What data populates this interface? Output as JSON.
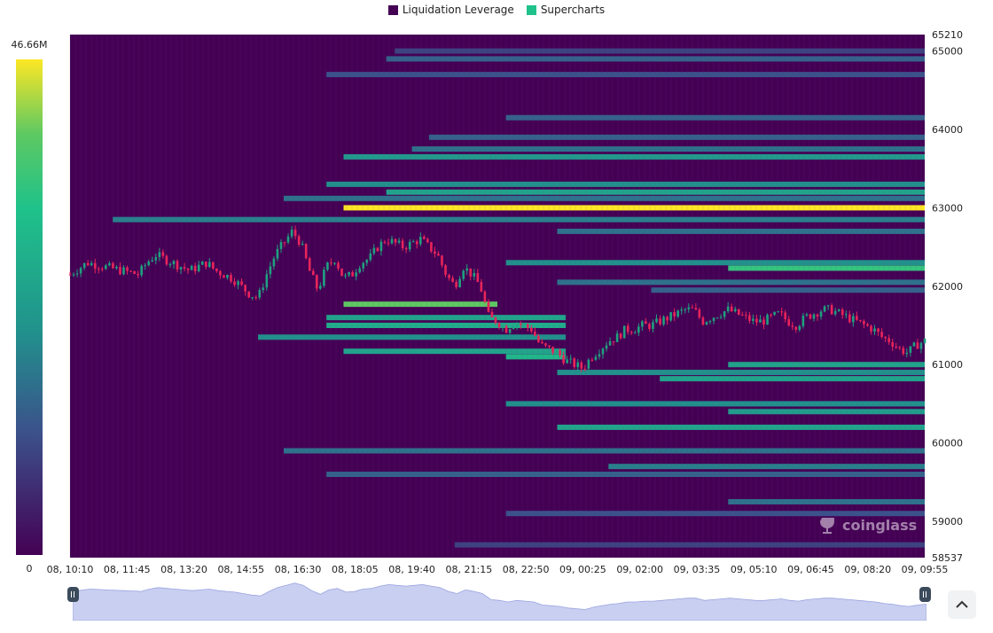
{
  "legend": [
    {
      "label": "Liquidation Leverage",
      "color": "#440154"
    },
    {
      "label": "Supercharts",
      "color": "#1fc28a"
    }
  ],
  "watermark": "coinglass",
  "chart_data": {
    "type": "heatmap",
    "title": "",
    "xlabel": "",
    "ylabel": "",
    "x_ticks": [
      "08, 10:10",
      "08, 11:45",
      "08, 13:20",
      "08, 14:55",
      "08, 16:30",
      "08, 18:05",
      "08, 19:40",
      "08, 21:15",
      "08, 22:50",
      "09, 00:25",
      "09, 02:00",
      "09, 03:35",
      "09, 05:10",
      "09, 06:45",
      "09, 08:20",
      "09, 09:55"
    ],
    "y_ticks": [
      65210,
      65000,
      64000,
      63000,
      62000,
      61000,
      60000,
      59000,
      58537
    ],
    "ylim": [
      58537,
      65210
    ],
    "colorbar": {
      "min_label": "0",
      "max_label": "46.66M",
      "min": 0,
      "max": 46660000,
      "colors": [
        "#440154",
        "#3b528b",
        "#21918c",
        "#1fc28a",
        "#5ec962",
        "#fde725"
      ]
    },
    "background_color": "#440154",
    "candle_colors": {
      "up": "#1fa07f",
      "down": "#e8245a"
    },
    "price_path": [
      [
        0,
        62150
      ],
      [
        0.02,
        62300
      ],
      [
        0.04,
        62250
      ],
      [
        0.06,
        62200
      ],
      [
        0.08,
        62150
      ],
      [
        0.09,
        62300
      ],
      [
        0.1,
        62400
      ],
      [
        0.11,
        62350
      ],
      [
        0.13,
        62250
      ],
      [
        0.14,
        62200
      ],
      [
        0.16,
        62300
      ],
      [
        0.17,
        62200
      ],
      [
        0.19,
        62100
      ],
      [
        0.2,
        62000
      ],
      [
        0.21,
        61900
      ],
      [
        0.22,
        61850
      ],
      [
        0.23,
        62150
      ],
      [
        0.24,
        62400
      ],
      [
        0.25,
        62550
      ],
      [
        0.26,
        62700
      ],
      [
        0.27,
        62550
      ],
      [
        0.28,
        62200
      ],
      [
        0.29,
        61950
      ],
      [
        0.3,
        62250
      ],
      [
        0.31,
        62350
      ],
      [
        0.32,
        62100
      ],
      [
        0.33,
        62150
      ],
      [
        0.34,
        62300
      ],
      [
        0.35,
        62350
      ],
      [
        0.36,
        62500
      ],
      [
        0.37,
        62600
      ],
      [
        0.38,
        62550
      ],
      [
        0.39,
        62500
      ],
      [
        0.4,
        62550
      ],
      [
        0.41,
        62600
      ],
      [
        0.42,
        62500
      ],
      [
        0.43,
        62400
      ],
      [
        0.44,
        62150
      ],
      [
        0.45,
        62000
      ],
      [
        0.46,
        62250
      ],
      [
        0.47,
        62150
      ],
      [
        0.48,
        62000
      ],
      [
        0.49,
        61600
      ],
      [
        0.5,
        61550
      ],
      [
        0.51,
        61450
      ],
      [
        0.52,
        61550
      ],
      [
        0.53,
        61500
      ],
      [
        0.54,
        61450
      ],
      [
        0.55,
        61250
      ],
      [
        0.56,
        61200
      ],
      [
        0.57,
        61150
      ],
      [
        0.58,
        61050
      ],
      [
        0.59,
        61000
      ],
      [
        0.6,
        60950
      ],
      [
        0.61,
        61100
      ],
      [
        0.62,
        61200
      ],
      [
        0.63,
        61300
      ],
      [
        0.64,
        61350
      ],
      [
        0.65,
        61450
      ],
      [
        0.66,
        61450
      ],
      [
        0.67,
        61500
      ],
      [
        0.68,
        61500
      ],
      [
        0.69,
        61550
      ],
      [
        0.7,
        61600
      ],
      [
        0.71,
        61650
      ],
      [
        0.72,
        61700
      ],
      [
        0.73,
        61700
      ],
      [
        0.74,
        61550
      ],
      [
        0.75,
        61600
      ],
      [
        0.76,
        61650
      ],
      [
        0.77,
        61700
      ],
      [
        0.78,
        61650
      ],
      [
        0.79,
        61600
      ],
      [
        0.8,
        61550
      ],
      [
        0.81,
        61550
      ],
      [
        0.82,
        61600
      ],
      [
        0.83,
        61650
      ],
      [
        0.84,
        61550
      ],
      [
        0.85,
        61500
      ],
      [
        0.86,
        61600
      ],
      [
        0.87,
        61650
      ],
      [
        0.88,
        61700
      ],
      [
        0.89,
        61700
      ],
      [
        0.9,
        61650
      ],
      [
        0.91,
        61600
      ],
      [
        0.92,
        61550
      ],
      [
        0.93,
        61500
      ],
      [
        0.94,
        61450
      ],
      [
        0.95,
        61350
      ],
      [
        0.96,
        61300
      ],
      [
        0.97,
        61200
      ],
      [
        0.98,
        61150
      ],
      [
        0.99,
        61250
      ],
      [
        1,
        61300
      ]
    ],
    "liquidation_bands": [
      {
        "price": 63000,
        "from": 0.32,
        "to": 1,
        "intensity": 1.0
      },
      {
        "price": 61770,
        "from": 0.32,
        "to": 0.5,
        "intensity": 0.85
      },
      {
        "price": 62230,
        "from": 0.77,
        "to": 1,
        "intensity": 0.75
      },
      {
        "price": 62300,
        "from": 0.51,
        "to": 1,
        "intensity": 0.45
      },
      {
        "price": 63200,
        "from": 0.37,
        "to": 1,
        "intensity": 0.55
      },
      {
        "price": 63300,
        "from": 0.3,
        "to": 1,
        "intensity": 0.45
      },
      {
        "price": 63120,
        "from": 0.25,
        "to": 1,
        "intensity": 0.35
      },
      {
        "price": 62850,
        "from": 0.05,
        "to": 1,
        "intensity": 0.4
      },
      {
        "price": 62700,
        "from": 0.57,
        "to": 1,
        "intensity": 0.35
      },
      {
        "price": 63650,
        "from": 0.32,
        "to": 1,
        "intensity": 0.5
      },
      {
        "price": 63750,
        "from": 0.4,
        "to": 1,
        "intensity": 0.35
      },
      {
        "price": 63900,
        "from": 0.42,
        "to": 1,
        "intensity": 0.3
      },
      {
        "price": 64150,
        "from": 0.51,
        "to": 1,
        "intensity": 0.3
      },
      {
        "price": 64700,
        "from": 0.3,
        "to": 1,
        "intensity": 0.25
      },
      {
        "price": 64900,
        "from": 0.37,
        "to": 1,
        "intensity": 0.3
      },
      {
        "price": 65000,
        "from": 0.38,
        "to": 1,
        "intensity": 0.2
      },
      {
        "price": 62050,
        "from": 0.57,
        "to": 1,
        "intensity": 0.35
      },
      {
        "price": 61950,
        "from": 0.68,
        "to": 1,
        "intensity": 0.3
      },
      {
        "price": 61600,
        "from": 0.3,
        "to": 0.58,
        "intensity": 0.55
      },
      {
        "price": 61500,
        "from": 0.3,
        "to": 0.58,
        "intensity": 0.6
      },
      {
        "price": 61350,
        "from": 0.22,
        "to": 0.58,
        "intensity": 0.45
      },
      {
        "price": 61170,
        "from": 0.32,
        "to": 0.58,
        "intensity": 0.55
      },
      {
        "price": 61100,
        "from": 0.51,
        "to": 0.58,
        "intensity": 0.65
      },
      {
        "price": 61000,
        "from": 0.77,
        "to": 1,
        "intensity": 0.55
      },
      {
        "price": 60900,
        "from": 0.57,
        "to": 1,
        "intensity": 0.45
      },
      {
        "price": 60820,
        "from": 0.69,
        "to": 1,
        "intensity": 0.55
      },
      {
        "price": 60500,
        "from": 0.51,
        "to": 1,
        "intensity": 0.45
      },
      {
        "price": 60400,
        "from": 0.77,
        "to": 1,
        "intensity": 0.5
      },
      {
        "price": 60200,
        "from": 0.57,
        "to": 1,
        "intensity": 0.55
      },
      {
        "price": 59900,
        "from": 0.25,
        "to": 1,
        "intensity": 0.35
      },
      {
        "price": 59700,
        "from": 0.63,
        "to": 1,
        "intensity": 0.4
      },
      {
        "price": 59600,
        "from": 0.3,
        "to": 1,
        "intensity": 0.3
      },
      {
        "price": 59250,
        "from": 0.77,
        "to": 1,
        "intensity": 0.35
      },
      {
        "price": 59100,
        "from": 0.51,
        "to": 1,
        "intensity": 0.25
      },
      {
        "price": 58700,
        "from": 0.45,
        "to": 1,
        "intensity": 0.2
      }
    ]
  }
}
